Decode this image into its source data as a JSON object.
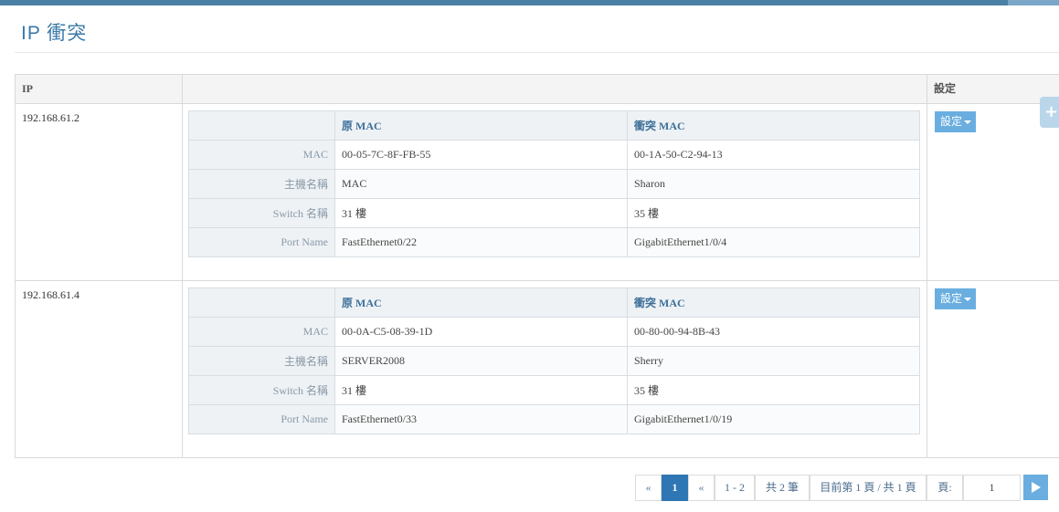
{
  "page": {
    "title": "IP 衝突"
  },
  "grid": {
    "columns": {
      "ip": "IP",
      "detail": "",
      "settings": "設定"
    },
    "rows": [
      {
        "ip": "192.168.61.2",
        "header": {
          "orig": "原 MAC",
          "conflict": "衝突 MAC"
        },
        "lines": [
          {
            "label": "MAC",
            "orig": "00-05-7C-8F-FB-55",
            "conflict": "00-1A-50-C2-94-13"
          },
          {
            "label": "主機名稱",
            "orig": "MAC",
            "conflict": "Sharon"
          },
          {
            "label": "Switch 名稱",
            "orig": "31 樓",
            "conflict": "35 樓"
          },
          {
            "label": "Port Name",
            "orig": "FastEthernet0/22",
            "conflict": "GigabitEthernet1/0/4"
          }
        ],
        "button": "設定"
      },
      {
        "ip": "192.168.61.4",
        "header": {
          "orig": "原 MAC",
          "conflict": "衝突 MAC"
        },
        "lines": [
          {
            "label": "MAC",
            "orig": "00-0A-C5-08-39-1D",
            "conflict": "00-80-00-94-8B-43"
          },
          {
            "label": "主機名稱",
            "orig": "SERVER2008",
            "conflict": "Sherry"
          },
          {
            "label": "Switch 名稱",
            "orig": "31 樓",
            "conflict": "35 樓"
          },
          {
            "label": "Port Name",
            "orig": "FastEthernet0/33",
            "conflict": "GigabitEthernet1/0/19"
          }
        ],
        "button": "設定"
      }
    ]
  },
  "side_tab": {
    "icon": "plus-icon",
    "glyph": "+"
  },
  "pagination": {
    "first": "«",
    "current_page": "1",
    "prev": "«",
    "range": "1 - 2",
    "total": "共 2 筆",
    "page_info": "目前第 1 頁 / 共 1 頁",
    "page_label": "頁:",
    "page_input": "1",
    "go_icon": "play-icon"
  },
  "colors": {
    "accent": "#3a78a8",
    "button": "#6aaee0",
    "active_page": "#2f76b4"
  }
}
